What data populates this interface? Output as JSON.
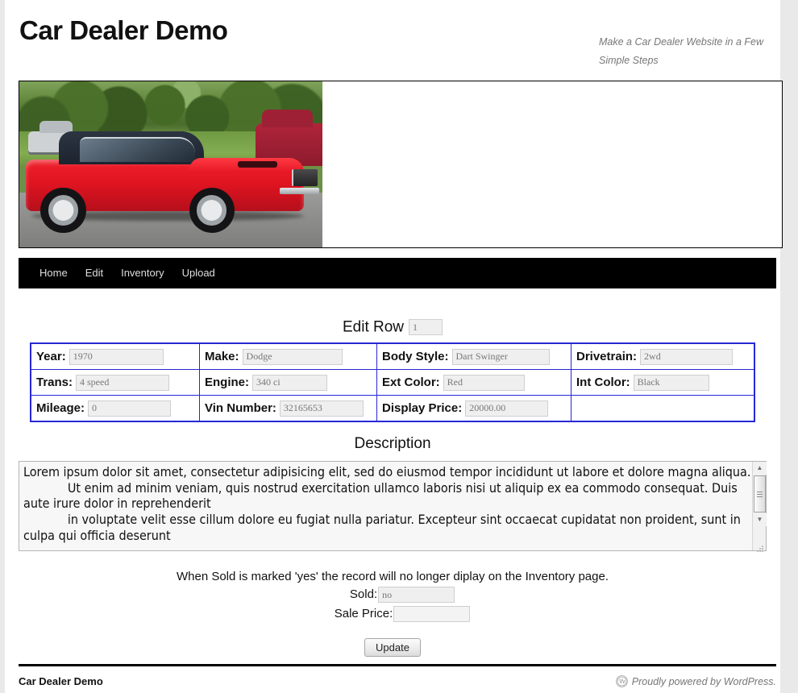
{
  "site": {
    "title": "Car Dealer Demo",
    "description": "Make a Car Dealer Website in a Few Simple Steps"
  },
  "header_image": {
    "alt": "Red 1970 Dodge Dart Swinger parked on pavement"
  },
  "nav": {
    "items": [
      {
        "label": "Home"
      },
      {
        "label": "Edit"
      },
      {
        "label": "Inventory"
      },
      {
        "label": "Upload"
      }
    ]
  },
  "edit_row": {
    "label": "Edit Row",
    "value": "1",
    "placeholder": ""
  },
  "fields": {
    "year": {
      "label": "Year:",
      "value": "1970"
    },
    "make": {
      "label": "Make:",
      "value": "Dodge"
    },
    "body": {
      "label": "Body Style:",
      "value": "Dart Swinger"
    },
    "drive": {
      "label": "Drivetrain:",
      "value": "2wd"
    },
    "trans": {
      "label": "Trans:",
      "value": "4 speed"
    },
    "engine": {
      "label": "Engine:",
      "value": "340 ci"
    },
    "ext": {
      "label": "Ext Color:",
      "value": "Red"
    },
    "int": {
      "label": "Int Color:",
      "value": "Black"
    },
    "mileage": {
      "label": "Mileage:",
      "value": "0"
    },
    "vin": {
      "label": "Vin Number:",
      "value": "32165653"
    },
    "price": {
      "label": "Display Price:",
      "value": "20000.00"
    }
  },
  "description": {
    "title": "Description",
    "value": "Lorem ipsum dolor sit amet, consectetur adipisicing elit, sed do eiusmod tempor incididunt ut labore et dolore magna aliqua.\n            Ut enim ad minim veniam, quis nostrud exercitation ullamco laboris nisi ut aliquip ex ea commodo consequat. Duis aute irure dolor in reprehenderit\n            in voluptate velit esse cillum dolore eu fugiat nulla pariatur. Excepteur sint occaecat cupidatat non proident, sunt in culpa qui officia deserunt"
  },
  "sold_section": {
    "note": "When Sold is marked 'yes' the record will no longer diplay on the Inventory page.",
    "sold": {
      "label": "Sold:",
      "value": "no"
    },
    "sale_price": {
      "label": "Sale Price:",
      "value": ""
    }
  },
  "actions": {
    "update_label": "Update"
  },
  "footer": {
    "title": "Car Dealer Demo",
    "credit": "Proudly powered by WordPress.",
    "badge_icon": "wordpress-icon"
  }
}
